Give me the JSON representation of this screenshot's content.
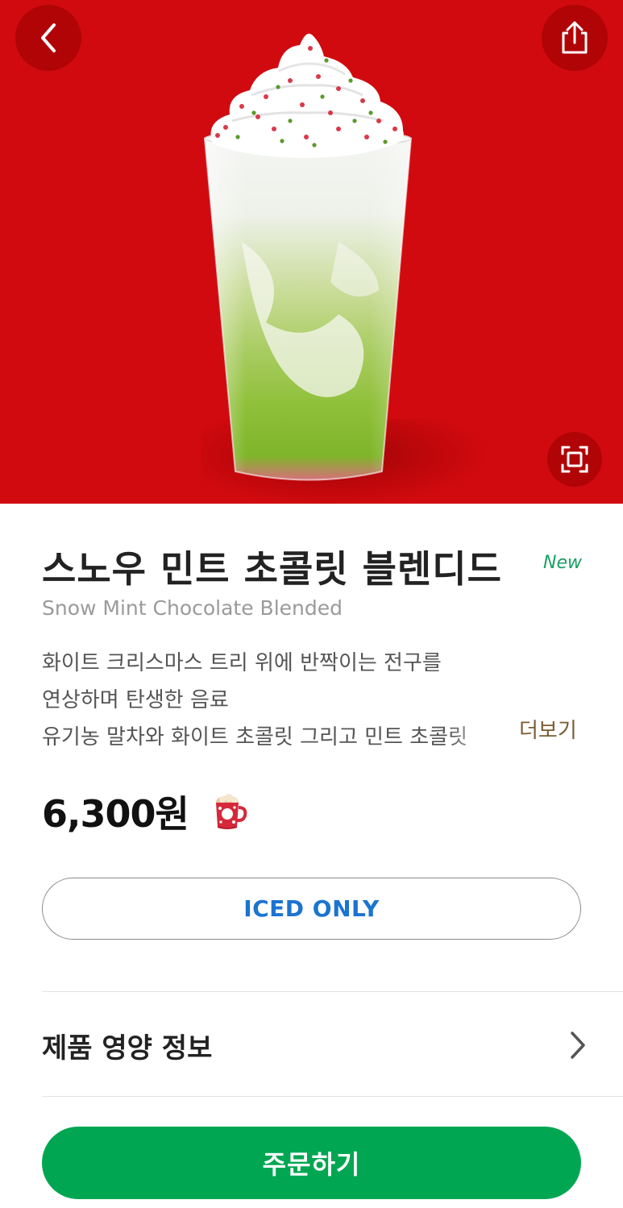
{
  "header": {
    "back_icon": "chevron-left-icon",
    "share_icon": "share-icon",
    "zoom_icon": "fullscreen-icon"
  },
  "product": {
    "name_ko": "스노우 민트 초콜릿 블렌디드",
    "badge": "New",
    "name_en": "Snow Mint Chocolate Blended",
    "description_lines": [
      "화이트 크리스마스 트리 위에 반짝이는 전구를",
      "연상하며 탄생한 음료",
      "유기농 말차와 화이트 초콜릿 그리고 민트 초콜릿"
    ],
    "more_label": "더보기",
    "price": "6,300원",
    "price_icon": "holiday-cup-icon"
  },
  "options": {
    "temperature_label": "ICED ONLY"
  },
  "nutrition": {
    "label": "제품 영양 정보",
    "chevron_icon": "chevron-right-icon"
  },
  "footer": {
    "order_label": "주문하기"
  },
  "colors": {
    "hero_bg": "#d10a0f",
    "accent_green": "#00a651",
    "badge_green": "#1aa060",
    "option_blue": "#1b74d1",
    "more_brown": "#7a5c33"
  }
}
